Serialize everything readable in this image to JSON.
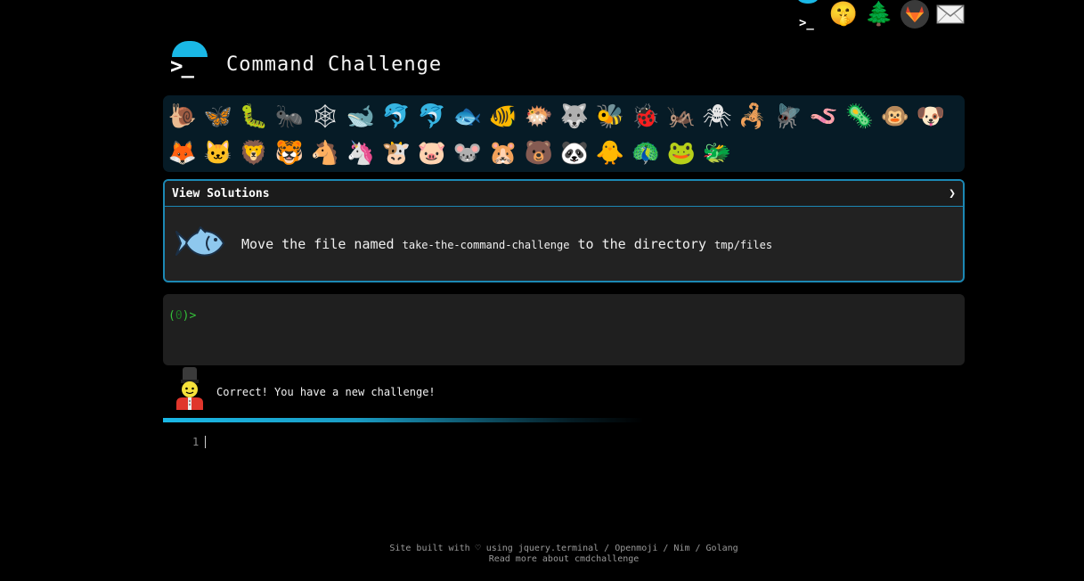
{
  "header": {
    "title": "Command Challenge"
  },
  "topbar": {
    "icons": [
      "terminal-icon",
      "shushing-face-icon",
      "tree-icon",
      "gitlab-icon",
      "mail-icon"
    ]
  },
  "creatures": {
    "row1": [
      "🐌",
      "🦋",
      "🐛",
      "🐜",
      "🕸",
      "🐋",
      "🐬",
      "🐬",
      "🐟",
      "🐠",
      "🐡",
      "🐺",
      "🐝",
      "🐞",
      "🦗",
      "🕷",
      "🦂",
      "🪰",
      "🪱",
      "🦠",
      "🐵",
      "🐶"
    ],
    "row2": [
      "🦊",
      "🐱",
      "🦁",
      "🐯",
      "🐴",
      "🦄",
      "🐮",
      "🐷",
      "🐭",
      "🐹",
      "🐻",
      "🐼",
      "🐥",
      "🦚",
      "🐸",
      "🐲"
    ]
  },
  "challenge": {
    "view_solutions_label": "View Solutions",
    "chevron": "❯",
    "text_before": "Move the file named ",
    "filename": "take-the-command-challenge",
    "text_middle": " to the directory ",
    "directory": "tmp/files"
  },
  "terminal": {
    "prompt_open": "(",
    "prompt_num": "0",
    "prompt_close": ")>"
  },
  "message": {
    "text": "Correct! You have a new challenge!"
  },
  "editor": {
    "line_number": "1"
  },
  "footer": {
    "line1": "Site built with ♡ using jquery.terminal / Openmoji / Nim / Golang",
    "line2": "Read more about cmdchallenge"
  },
  "colors": {
    "accent": "#1ab8e6",
    "border": "#1c88b4",
    "prompt": "#35c23a"
  }
}
